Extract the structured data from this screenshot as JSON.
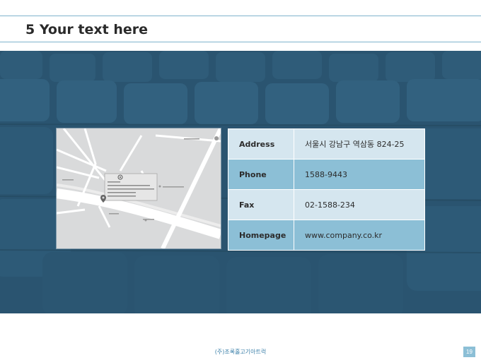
{
  "header": {
    "title": "5 Your text here"
  },
  "contact": [
    {
      "label": "Address",
      "value": "서울시 강남구 역삼동 824-25"
    },
    {
      "label": "Phone",
      "value": "1588-9443"
    },
    {
      "label": "Fax",
      "value": "02-1588-234"
    },
    {
      "label": "Homepage",
      "value": "www.company.co.kr"
    }
  ],
  "footer": {
    "company": "(주)조록홀고기아트럭",
    "page": "19"
  },
  "icons": {
    "map_pin": "map-pin-icon",
    "map_logo": "map-logo-icon"
  },
  "colors": {
    "accent_blue": "#8cbfd6",
    "light_blue": "#d5e6ef",
    "banner": "#2a5470",
    "rule": "#7fb3cc"
  }
}
